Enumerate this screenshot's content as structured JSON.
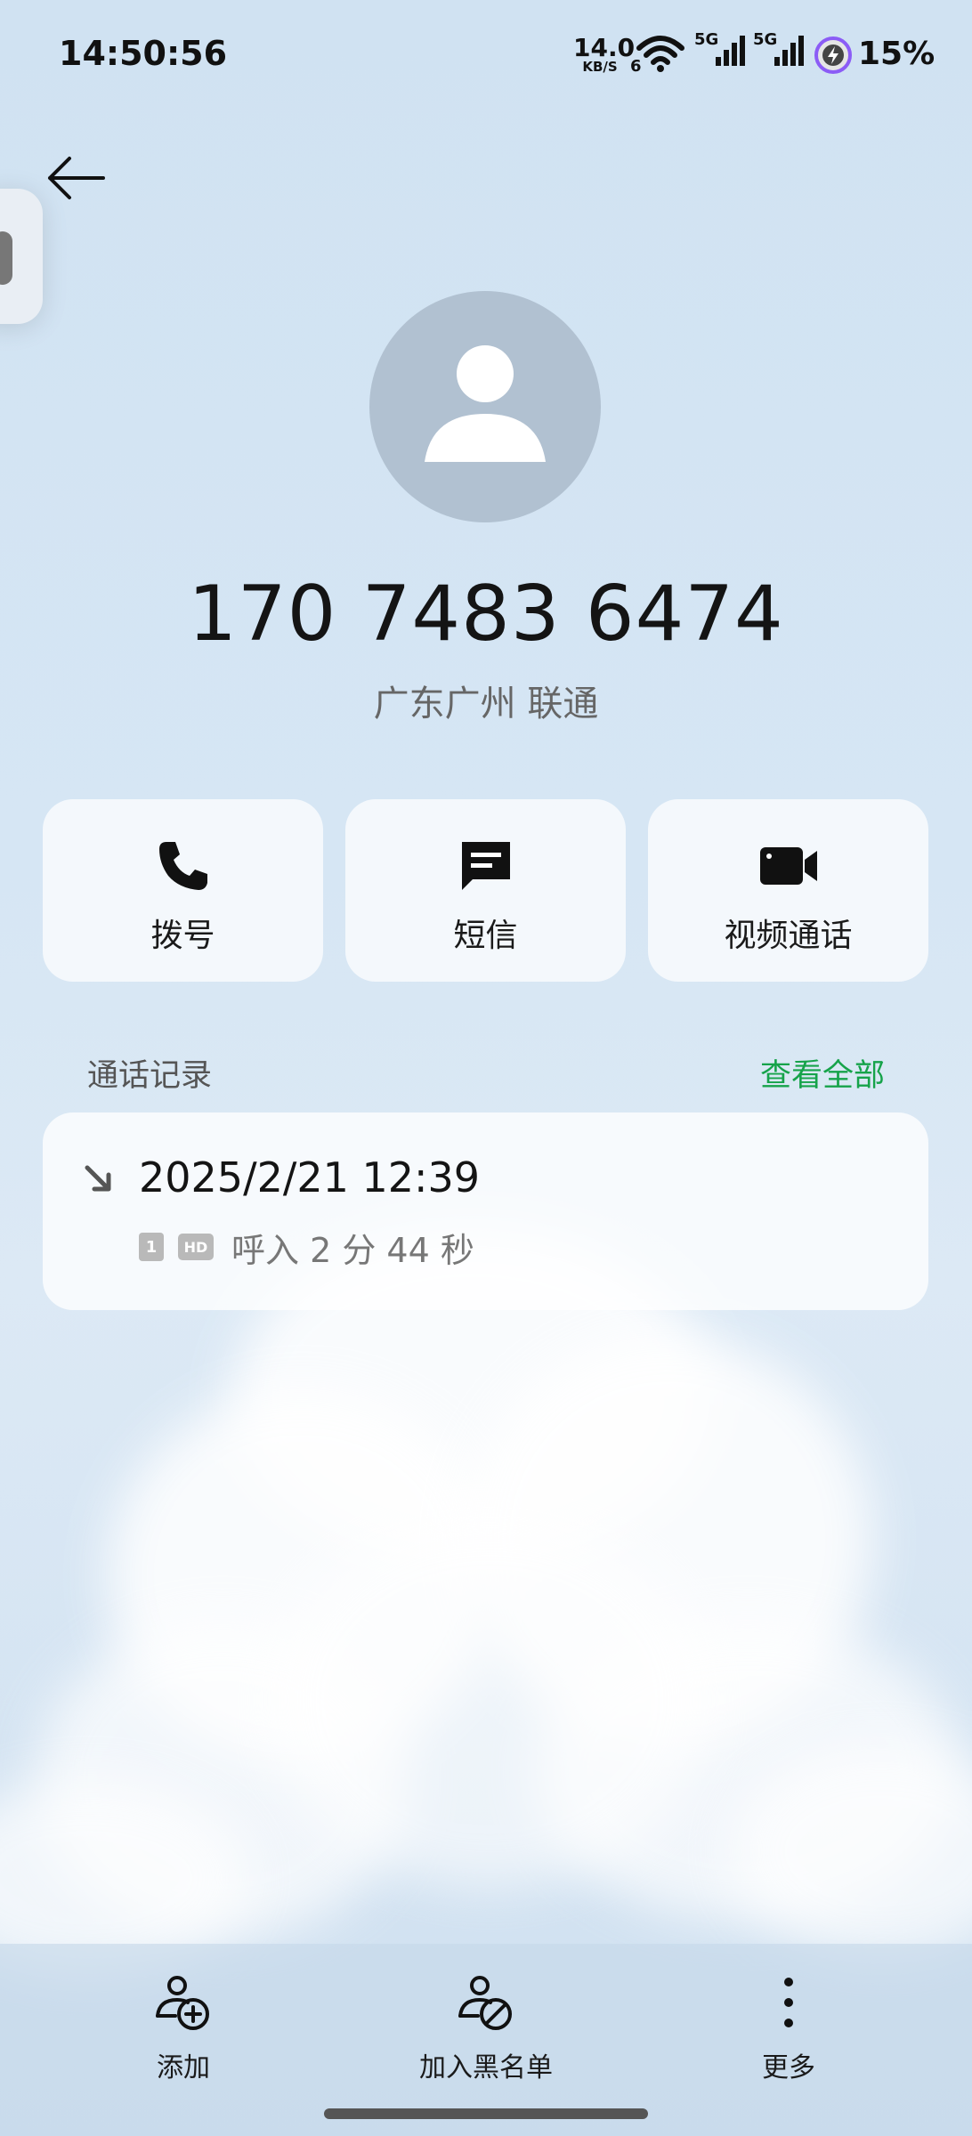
{
  "status_bar": {
    "time": "14:50:56",
    "net_speed": "14.0",
    "net_speed_unit": "KB/S",
    "wifi_sub": "6",
    "sim1_label": "5G",
    "sim2_label": "5G",
    "battery_percent": "15%"
  },
  "contact": {
    "phone_number": "170 7483 6474",
    "location": "广东广州 联通"
  },
  "actions": {
    "dial_label": "拨号",
    "sms_label": "短信",
    "video_label": "视频通话"
  },
  "call_log": {
    "section_title": "通话记录",
    "view_all_label": "查看全部",
    "records": [
      {
        "datetime": "2025/2/21 12:39",
        "sim": "1",
        "hd": "HD",
        "description": "呼入  2 分 44 秒"
      }
    ]
  },
  "bottom_bar": {
    "add_label": "添加",
    "block_label": "加入黑名单",
    "more_label": "更多"
  },
  "colors": {
    "accent_green": "#16a34a",
    "avatar_bg": "#b1c1d1"
  },
  "icons": [
    "back-arrow-icon",
    "phone-icon",
    "message-icon",
    "video-camera-icon",
    "incoming-call-icon",
    "add-contact-icon",
    "block-contact-icon",
    "more-vertical-icon",
    "wifi-icon",
    "signal-icon",
    "battery-charging-icon"
  ]
}
